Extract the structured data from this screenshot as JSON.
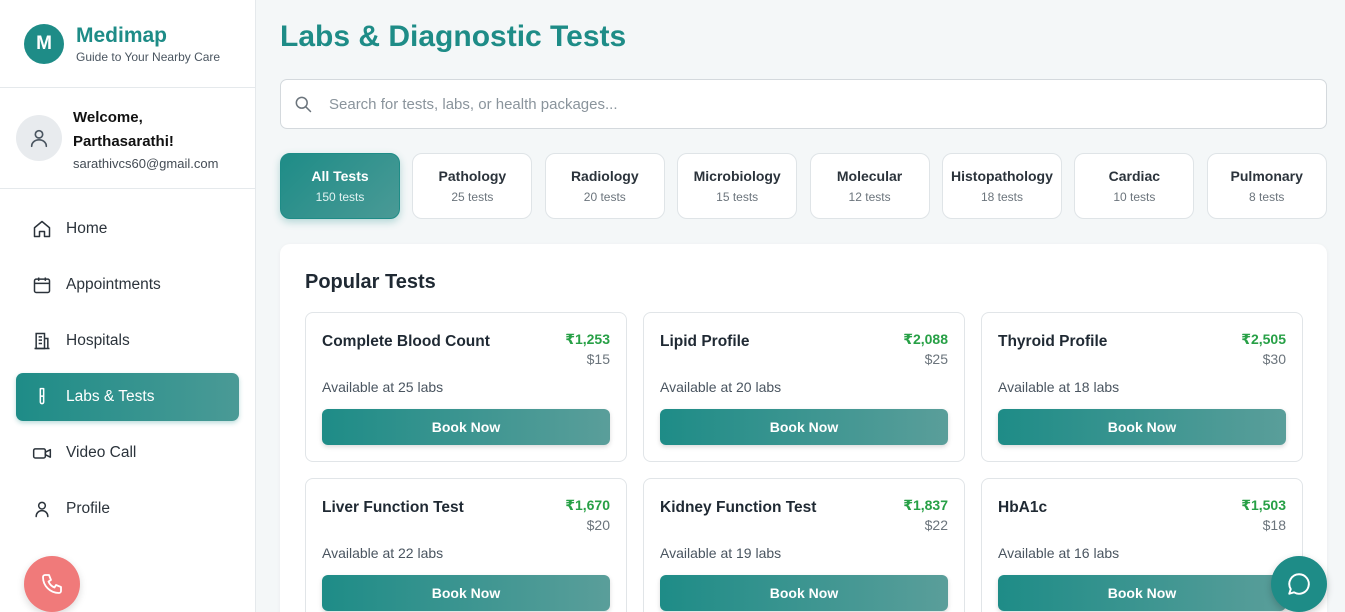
{
  "brand": {
    "logo_letter": "M",
    "name": "Medimap",
    "tagline": "Guide to Your Nearby Care"
  },
  "user": {
    "welcome_line1": "Welcome,",
    "welcome_line2": "Parthasarathi!",
    "email": "sarathivcs60@gmail.com"
  },
  "nav": [
    {
      "label": "Home",
      "icon": "home-icon"
    },
    {
      "label": "Appointments",
      "icon": "calendar-icon"
    },
    {
      "label": "Hospitals",
      "icon": "hospital-icon"
    },
    {
      "label": "Labs & Tests",
      "icon": "test-tube-icon",
      "active": true
    },
    {
      "label": "Video Call",
      "icon": "video-icon"
    },
    {
      "label": "Profile",
      "icon": "user-icon"
    }
  ],
  "page": {
    "title": "Labs & Diagnostic Tests"
  },
  "search": {
    "placeholder": "Search for tests, labs, or health packages..."
  },
  "categories": [
    {
      "name": "All Tests",
      "count": "150 tests",
      "active": true
    },
    {
      "name": "Pathology",
      "count": "25 tests"
    },
    {
      "name": "Radiology",
      "count": "20 tests"
    },
    {
      "name": "Microbiology",
      "count": "15 tests"
    },
    {
      "name": "Molecular",
      "count": "12 tests"
    },
    {
      "name": "Histopathology",
      "count": "18 tests"
    },
    {
      "name": "Cardiac",
      "count": "10 tests"
    },
    {
      "name": "Pulmonary",
      "count": "8 tests"
    }
  ],
  "popular": {
    "title": "Popular Tests",
    "book_label": "Book Now",
    "tests": [
      {
        "name": "Complete Blood Count",
        "price_inr": "₹1,253",
        "price_usd": "$15",
        "availability": "Available at 25 labs"
      },
      {
        "name": "Lipid Profile",
        "price_inr": "₹2,088",
        "price_usd": "$25",
        "availability": "Available at 20 labs"
      },
      {
        "name": "Thyroid Profile",
        "price_inr": "₹2,505",
        "price_usd": "$30",
        "availability": "Available at 18 labs"
      },
      {
        "name": "Liver Function Test",
        "price_inr": "₹1,670",
        "price_usd": "$20",
        "availability": "Available at 22 labs"
      },
      {
        "name": "Kidney Function Test",
        "price_inr": "₹1,837",
        "price_usd": "$22",
        "availability": "Available at 19 labs"
      },
      {
        "name": "HbA1c",
        "price_inr": "₹1,503",
        "price_usd": "$18",
        "availability": "Available at 16 labs"
      }
    ]
  },
  "colors": {
    "primary": "#1e8c87",
    "price_green": "#27a046",
    "call_button": "#f07a7a"
  },
  "fabs": {
    "call_icon": "phone-icon",
    "chat_icon": "chat-icon"
  }
}
